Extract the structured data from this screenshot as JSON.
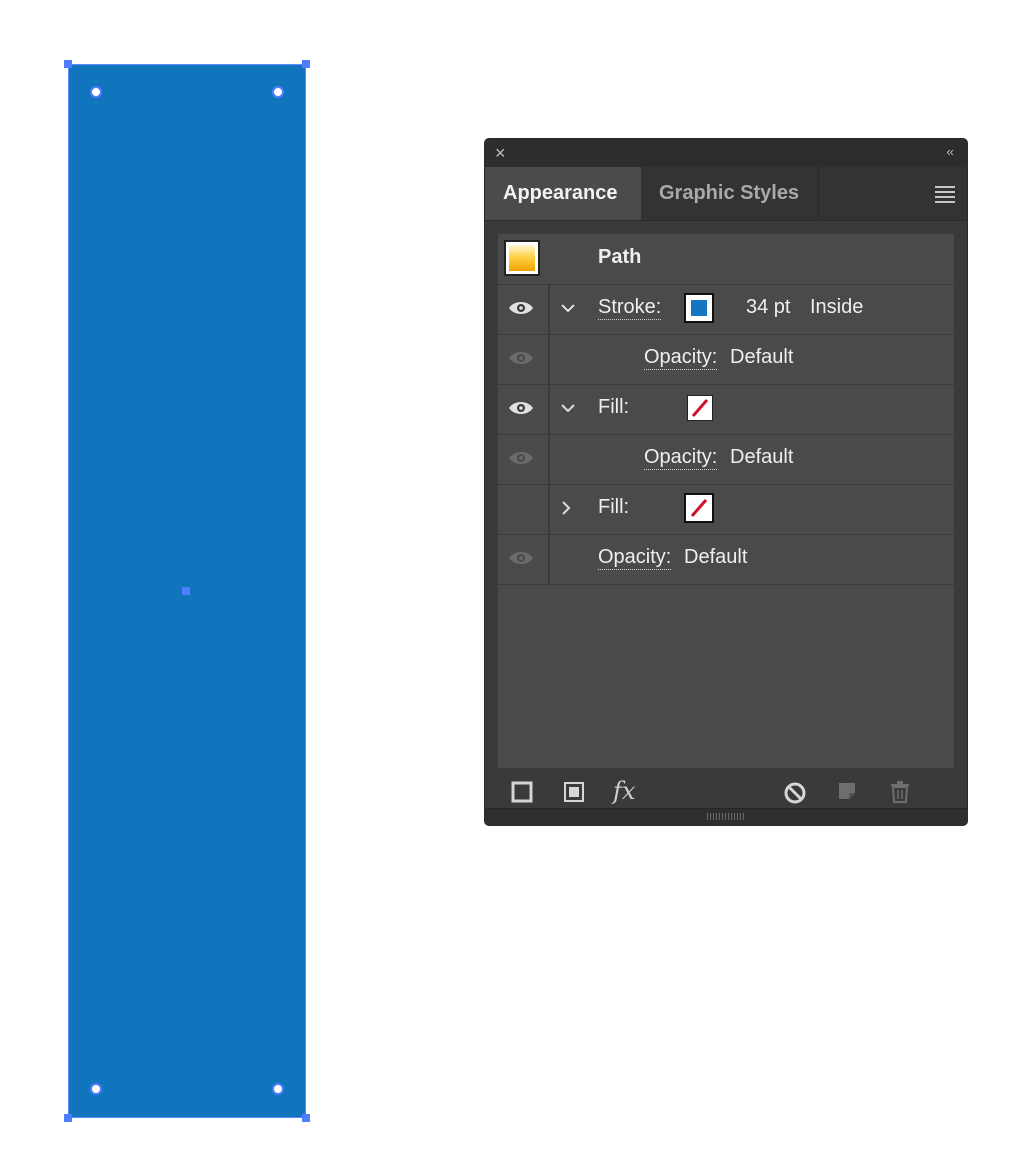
{
  "colors": {
    "object_fill": "#1075bd",
    "selection": "#4f7dff",
    "stroke_swatch": "#1575c0",
    "none_slash": "#d0102a"
  },
  "panel": {
    "close_icon": "×",
    "collapse_icon": "‹‹",
    "tabs": [
      {
        "label": "Appearance",
        "active": true
      },
      {
        "label": "Graphic Styles",
        "active": false
      }
    ],
    "object_title": "Path",
    "rows": [
      {
        "kind": "stroke",
        "visible": true,
        "expanded": true,
        "label": "Stroke:",
        "weight": "34 pt",
        "align": "Inside"
      },
      {
        "kind": "opacity",
        "visible": false,
        "label": "Opacity:",
        "value": "Default"
      },
      {
        "kind": "fill",
        "visible": true,
        "expanded": true,
        "label": "Fill:",
        "swatch": "none"
      },
      {
        "kind": "opacity",
        "visible": false,
        "label": "Opacity:",
        "value": "Default"
      },
      {
        "kind": "fill",
        "expanded": false,
        "label": "Fill:",
        "swatch": "none"
      },
      {
        "kind": "opacity",
        "visible": false,
        "label": "Opacity:",
        "value": "Default"
      }
    ],
    "footer_icons": [
      "add-stroke-icon",
      "add-fill-icon",
      "fx-icon",
      "clear-appearance-icon",
      "duplicate-item-icon",
      "delete-item-icon"
    ],
    "fx_label": "fx"
  }
}
